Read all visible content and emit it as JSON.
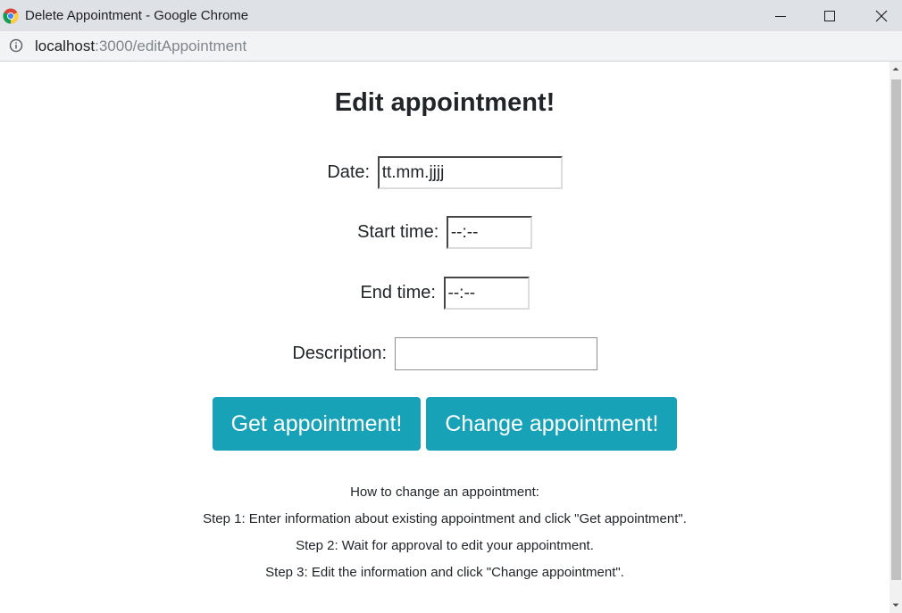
{
  "window": {
    "title": "Delete Appointment - Google Chrome"
  },
  "address_bar": {
    "host": "localhost",
    "path": ":3000/editAppointment"
  },
  "page": {
    "heading": "Edit appointment!",
    "form": {
      "date_label": "Date:",
      "date_value": "tt.mm.jjjj",
      "start_label": "Start time:",
      "start_value": "--:--",
      "end_label": "End time:",
      "end_value": "--:--",
      "description_label": "Description:",
      "description_value": ""
    },
    "buttons": {
      "get_label": "Get appointment!",
      "change_label": "Change appointment!"
    },
    "instructions": [
      "How to change an appointment:",
      "Step 1: Enter information about existing appointment and click \"Get appointment\".",
      "Step 2: Wait for approval to edit your appointment.",
      "Step 3: Edit the information and click \"Change appointment\"."
    ]
  },
  "colors": {
    "button": "#17a2b8",
    "titlebar": "#dee1e6",
    "addressbar": "#f1f3f4"
  },
  "icons": {
    "browser": "chrome-logo-icon",
    "site_info": "info-icon",
    "minimize": "minimize-icon",
    "maximize": "maximize-icon",
    "close": "close-icon"
  }
}
